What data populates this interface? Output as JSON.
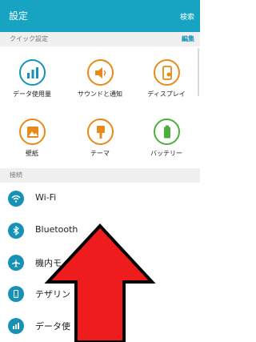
{
  "header": {
    "title": "設定",
    "search_label": "検索"
  },
  "quick_settings": {
    "title": "クイック設定",
    "edit_label": "編集",
    "tiles": [
      {
        "label": "データ使用量",
        "icon": "bar-chart-icon"
      },
      {
        "label": "サウンドと通知",
        "icon": "speaker-icon"
      },
      {
        "label": "ディスプレイ",
        "icon": "display-icon"
      },
      {
        "label": "壁紙",
        "icon": "wallpaper-icon"
      },
      {
        "label": "テーマ",
        "icon": "paintbrush-icon"
      },
      {
        "label": "バッテリー",
        "icon": "battery-icon"
      }
    ]
  },
  "connections": {
    "title": "接続",
    "items": [
      {
        "label": "Wi-Fi",
        "icon": "wifi-icon"
      },
      {
        "label": "Bluetooth",
        "icon": "bluetooth-icon"
      },
      {
        "label": "機内モ",
        "icon": "airplane-icon"
      },
      {
        "label": "テザリン",
        "icon": "tethering-icon"
      },
      {
        "label": "データ使",
        "icon": "data-usage-icon"
      }
    ]
  },
  "colors": {
    "header_bg": "#17a4c2",
    "accent": "#1592b5",
    "quick_orange": "#e88a1a",
    "battery_green": "#4caf3d",
    "arrow_red": "#ee1c1c"
  }
}
